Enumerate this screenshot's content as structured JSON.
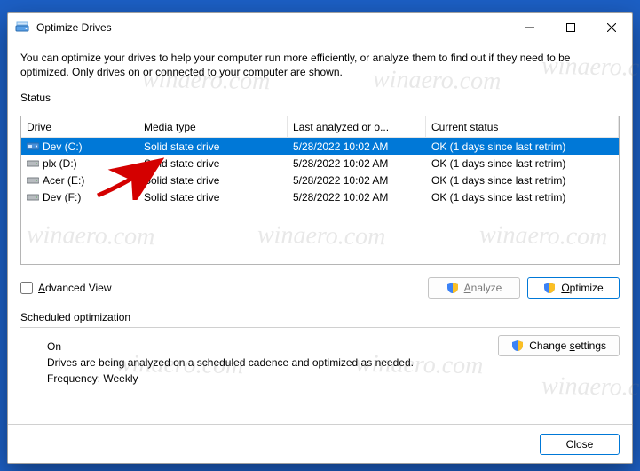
{
  "window": {
    "title": "Optimize Drives"
  },
  "description": "You can optimize your drives to help your computer run more efficiently, or analyze them to find out if they need to be optimized. Only drives on or connected to your computer are shown.",
  "status_label": "Status",
  "columns": {
    "drive": "Drive",
    "media": "Media type",
    "last": "Last analyzed or o...",
    "status": "Current status"
  },
  "drives": [
    {
      "name": "Dev (C:)",
      "icon": "ssd",
      "media": "Solid state drive",
      "last": "5/28/2022 10:02 AM",
      "status": "OK (1 days since last retrim)",
      "selected": true
    },
    {
      "name": "plx (D:)",
      "icon": "hdd",
      "media": "Solid state drive",
      "last": "5/28/2022 10:02 AM",
      "status": "OK (1 days since last retrim)",
      "selected": false
    },
    {
      "name": "Acer (E:)",
      "icon": "hdd",
      "media": "Solid state drive",
      "last": "5/28/2022 10:02 AM",
      "status": "OK (1 days since last retrim)",
      "selected": false
    },
    {
      "name": "Dev (F:)",
      "icon": "hdd",
      "media": "Solid state drive",
      "last": "5/28/2022 10:02 AM",
      "status": "OK (1 days since last retrim)",
      "selected": false
    }
  ],
  "advanced_view": {
    "label_pre": "A",
    "label_post": "dvanced View",
    "checked": false
  },
  "buttons": {
    "analyze_pre": "A",
    "analyze_post": "nalyze",
    "optimize_pre": "O",
    "optimize_post": "ptimize",
    "change_pre": "Change ",
    "change_hot": "s",
    "change_post": "ettings",
    "close": "Close"
  },
  "scheduled": {
    "label": "Scheduled optimization",
    "on": "On",
    "desc": "Drives are being analyzed on a scheduled cadence and optimized as needed.",
    "freq": "Frequency: Weekly"
  },
  "watermark": "winaero.com"
}
